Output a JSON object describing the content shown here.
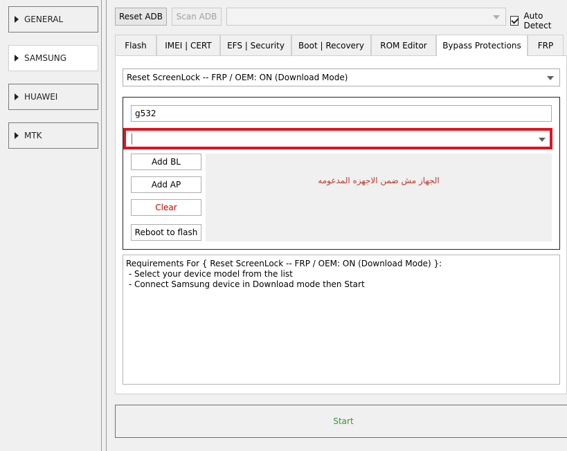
{
  "sidebar": {
    "items": [
      {
        "label": "GENERAL"
      },
      {
        "label": "SAMSUNG"
      },
      {
        "label": "HUAWEI"
      },
      {
        "label": "MTK"
      }
    ]
  },
  "toolbar": {
    "reset_adb": "Reset ADB",
    "scan_adb": "Scan ADB",
    "device_select_value": "",
    "auto_detect_label": "Auto Detect",
    "auto_detect_checked": true
  },
  "tabs": [
    {
      "label": "Flash"
    },
    {
      "label": "IMEI | CERT"
    },
    {
      "label": "EFS | Security"
    },
    {
      "label": "Boot | Recovery"
    },
    {
      "label": "ROM Editor"
    },
    {
      "label": "Bypass Protections",
      "active": true
    },
    {
      "label": "FRP"
    }
  ],
  "bypass": {
    "operation_select": "Reset ScreenLock -- FRP / OEM: ON (Download Mode)",
    "model_search": "g532",
    "model_select_value": "",
    "buttons": {
      "add_bl": "Add BL",
      "add_ap": "Add AP",
      "clear": "Clear",
      "reboot": "Reboot to flash"
    },
    "message": "الجهاز مش ضمن الاجهزه المدعومه",
    "requirements": [
      "Requirements For { Reset ScreenLock -- FRP / OEM: ON (Download Mode) }:",
      " - Select your device model from the list",
      " - Connect Samsung device in Download mode then Start"
    ]
  },
  "start_label": "Start",
  "colors": {
    "highlight": "#e0141e",
    "clear_text": "#cc0000",
    "message_text": "#c0392b",
    "start_text": "#2e9a2e"
  }
}
